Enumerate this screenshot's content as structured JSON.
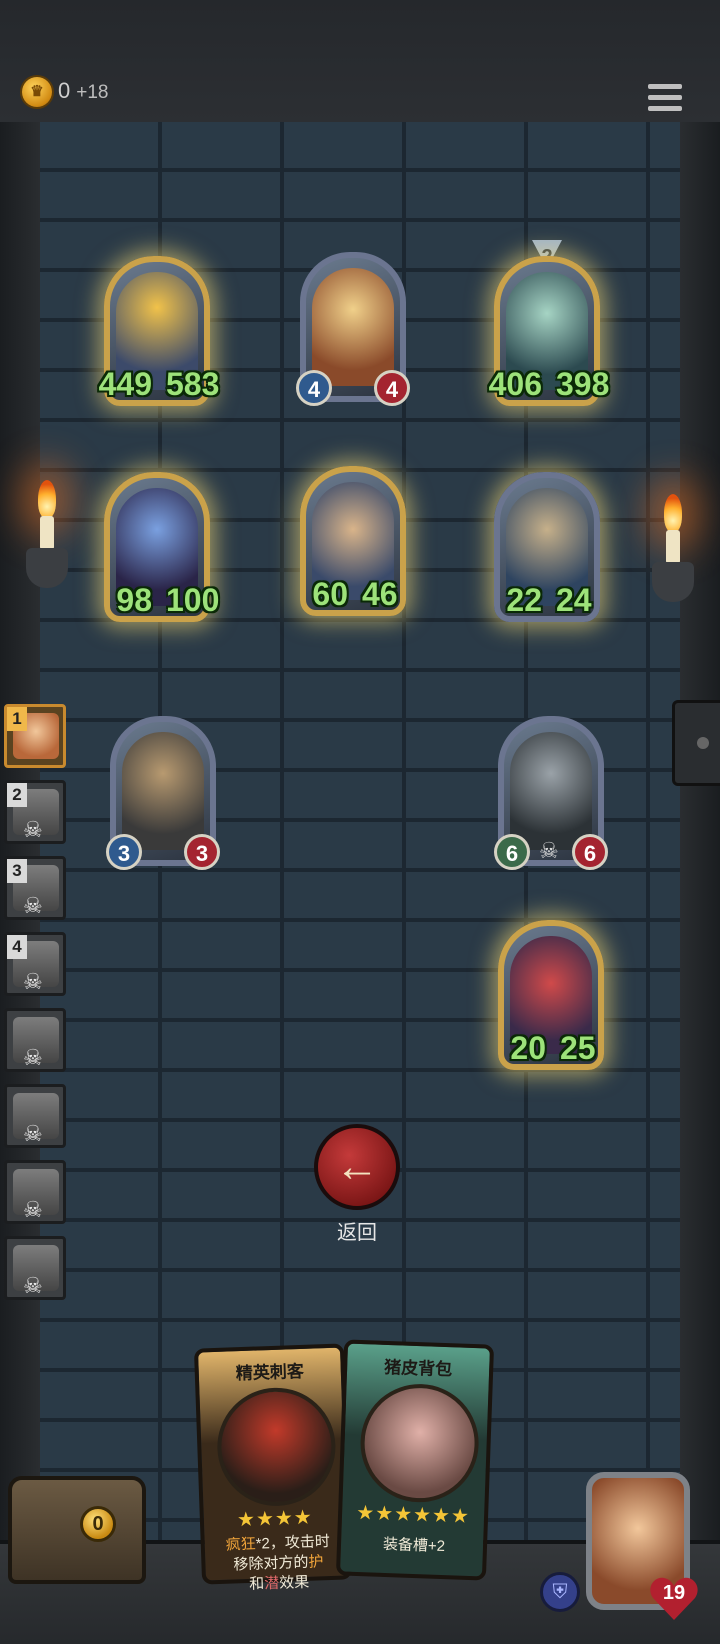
{
  "header": {
    "gold": "0",
    "gold_income": "+18"
  },
  "board": {
    "enemy_row1": [
      {
        "atk": "449",
        "hp": "583"
      },
      {
        "atk": "4",
        "hp": "4"
      },
      {
        "atk": "406",
        "hp": "398",
        "tier": "2"
      }
    ],
    "enemy_row2": [
      {
        "atk": "98",
        "hp": "100"
      },
      {
        "atk": "60",
        "hp": "46"
      },
      {
        "atk": "22",
        "hp": "24"
      }
    ],
    "player_row": [
      {
        "atk": "3",
        "hp": "3"
      },
      {
        "atk": "6",
        "hp": "6"
      }
    ],
    "player_row2": [
      {
        "atk": "20",
        "hp": "25"
      }
    ]
  },
  "sidebar": {
    "slots": [
      "1",
      "2",
      "3",
      "4",
      "",
      "",
      "",
      ""
    ]
  },
  "back": {
    "label": "返回",
    "icon": "arrow-left-icon"
  },
  "hand": [
    {
      "title": "精英刺客",
      "stars": "★★★★",
      "line1a": "疯狂",
      "line1b": "*2，攻击时",
      "line2a": "移除对方的",
      "line2b": "护",
      "line3a": "和",
      "line3b": "潜",
      "line3c": "效果"
    },
    {
      "title": "猪皮背包",
      "stars": "★★★★★★",
      "desc": "装备槽+2"
    }
  ],
  "footer": {
    "chest_count": "0",
    "hero_hp": "19"
  },
  "colors": {
    "gold_frame": "#caa24a",
    "stat_green": "#9de27a",
    "attack_blue": "#2f5a8e",
    "health_red": "#a42430",
    "back_red": "#c43a3a"
  }
}
